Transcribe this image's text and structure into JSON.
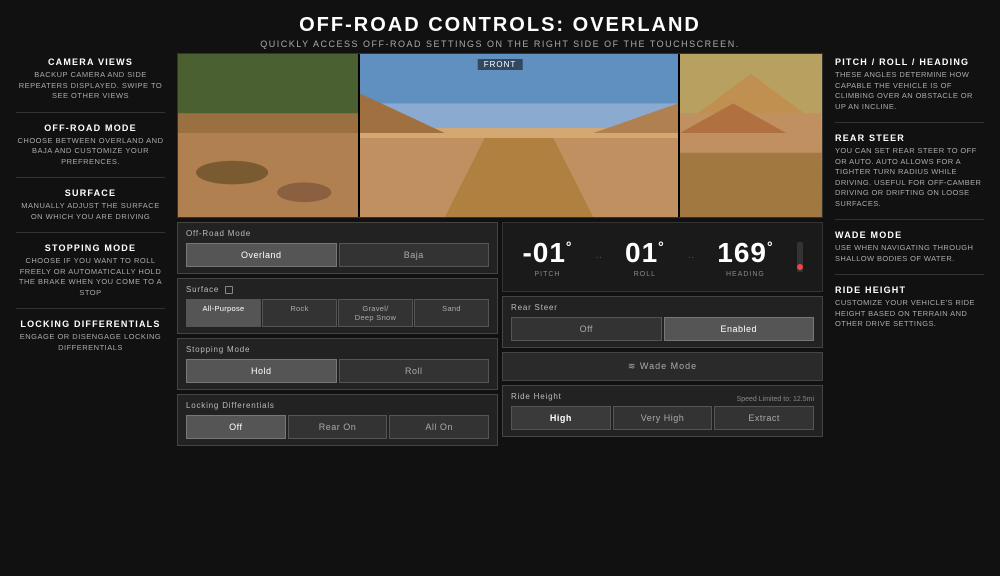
{
  "header": {
    "title": "OFF-ROAD CONTROLS: OVERLAND",
    "subtitle": "QUICKLY ACCESS OFF-ROAD SETTINGS ON THE RIGHT SIDE OF THE TOUCHSCREEN."
  },
  "left_sidebar": {
    "sections": [
      {
        "id": "camera-views",
        "label": "CAMERA VIEWS",
        "desc": "BACKUP CAMERA AND SIDE REPEATERS DISPLAYED. SWIPE TO SEE OTHER VIEWS"
      },
      {
        "id": "off-road-mode",
        "label": "OFF-ROAD MODE",
        "desc": "CHOOSE BETWEEN OVERLAND AND BAJA AND CUSTOMIZE YOUR PREFRENCES."
      },
      {
        "id": "surface",
        "label": "SURFACE",
        "desc": "MANUALLY ADJUST THE SURFACE ON WHICH YOU ARE DRIVING"
      },
      {
        "id": "stopping-mode",
        "label": "STOPPING MODE",
        "desc": "CHOOSE IF YOU WANT TO ROLL FREELY OR AUTOMATICALLY HOLD THE BRAKE WHEN YOU COME TO A STOP"
      },
      {
        "id": "locking-differentials",
        "label": "LOCKING DIFFERENTIALS",
        "desc": "ENGAGE OR DISENGAGE LOCKING DIFFERENTIALS"
      }
    ]
  },
  "camera": {
    "front_label": "FRONT"
  },
  "controls": {
    "off_road_mode": {
      "label": "Off-Road Mode",
      "buttons": [
        "Overland",
        "Baja"
      ],
      "active": 0
    },
    "surface": {
      "label": "Surface",
      "buttons": [
        "All-Purpose",
        "Rock",
        "Gravel/ Deep Snow",
        "Sand"
      ],
      "active": 0
    },
    "stopping_mode": {
      "label": "Stopping Mode",
      "buttons": [
        "Hold",
        "Roll"
      ],
      "active": 0
    },
    "locking_differentials": {
      "label": "Locking Differentials",
      "buttons": [
        "Off",
        "Rear On",
        "All On"
      ],
      "active": 0
    }
  },
  "pitch_display": {
    "pitch_value": "-01",
    "pitch_label": "PITCH",
    "roll_value": "01",
    "roll_label": "ROLL",
    "heading_value": "169",
    "heading_label": "HEADING"
  },
  "rear_steer": {
    "label": "Rear Steer",
    "buttons": [
      "Off",
      "Enabled"
    ],
    "active": 1
  },
  "wade_mode": {
    "label": "≋ Wade Mode"
  },
  "ride_height": {
    "label": "Ride Height",
    "speed_label": "Speed Limited to: 12.5mi",
    "buttons": [
      "High",
      "Very High",
      "Extract"
    ],
    "active": 0
  },
  "right_sidebar": {
    "sections": [
      {
        "id": "pitch-roll-heading",
        "label": "PITCH / ROLL / HEADING",
        "desc": "THESE ANGLES DETERMINE HOW CAPABLE THE VEHICLE IS OF CLIMBING OVER AN OBSTACLE OR UP AN INCLINE."
      },
      {
        "id": "rear-steer",
        "label": "REAR STEER",
        "desc": "YOU CAN SET REAR STEER TO OFF OR AUTO. AUTO ALLOWS FOR A TIGHTER TURN RADIUS WHILE DRIVING. USEFUL FOR OFF-CAMBER DRIVING OR DRIFTING ON LOOSE SURFACES."
      },
      {
        "id": "wade-mode",
        "label": "WADE MODE",
        "desc": "USE WHEN NAVIGATING THROUGH SHALLOW BODIES OF WATER."
      },
      {
        "id": "ride-height",
        "label": "RIDE HEIGHT",
        "desc": "CUSTOMIZE YOUR VEHICLE'S RIDE HEIGHT BASED ON TERRAIN AND OTHER DRIVE SETTINGS."
      }
    ]
  }
}
